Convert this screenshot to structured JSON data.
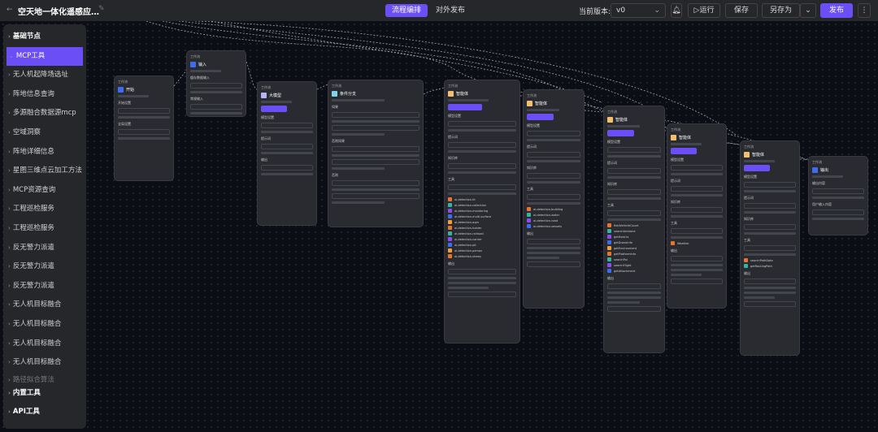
{
  "header": {
    "back_icon": "arrow-left-icon",
    "title": "空天地一体化遥感应…",
    "edit_icon": "pencil-icon",
    "tabs": [
      {
        "label": "流程编排",
        "active": true
      },
      {
        "label": "对外发布",
        "active": false
      }
    ],
    "version_label": "当前版本:",
    "version_value": "v0",
    "bell_icon": "bell-icon",
    "run_label": "▷运行",
    "save_label": "保存",
    "save_as_label": "另存为",
    "save_as_menu_icon": "chevron-down-icon",
    "publish_label": "发布",
    "more_icon": "more-vertical-icon",
    "accent": "#6b4ef6"
  },
  "sidebar": {
    "items": [
      {
        "label": "基础节点",
        "bold": true
      },
      {
        "label": "MCP工具",
        "active": true
      },
      {
        "label": "无人机起降场选址"
      },
      {
        "label": "阵地信息查询"
      },
      {
        "label": "多源融合数据源mcp"
      },
      {
        "label": "空域洞察"
      },
      {
        "label": "阵地详细信息"
      },
      {
        "label": "星图三维点云加工方法"
      },
      {
        "label": "MCP资源查询"
      },
      {
        "label": "工程巡检服务"
      },
      {
        "label": "工程巡检服务"
      },
      {
        "label": "反无警力派遣"
      },
      {
        "label": "反无警力派遣"
      },
      {
        "label": "反无警力派遣"
      },
      {
        "label": "无人机目标融合"
      },
      {
        "label": "无人机目标融合"
      },
      {
        "label": "无人机目标融合"
      },
      {
        "label": "无人机目标融合"
      },
      {
        "label": "路径拟合算法",
        "cut": true
      },
      {
        "label": "内置工具",
        "bold": true
      },
      {
        "label": "API工具",
        "bold": true
      }
    ]
  },
  "nodes": [
    {
      "type": "工作流",
      "title": "开始",
      "color": "#3d6cf0",
      "fields": [
        "开始设置",
        "全局设置"
      ]
    },
    {
      "type": "工作流",
      "title": "输入",
      "color": "#3d6cf0",
      "fields": [
        "缓存数据输入",
        "常规输入"
      ]
    },
    {
      "type": "工作流",
      "title": "大模型",
      "color": "#b9b3f5",
      "fields": [
        "模型设置",
        "提示词",
        "输出"
      ]
    },
    {
      "type": "工作流",
      "title": "条件分支",
      "color": "#7fd4e8",
      "fields": [
        "如果",
        "否则如果",
        "否则"
      ]
    },
    {
      "type": "工作流",
      "title": "智能体",
      "color": "#f3c070",
      "fields": [
        "模型设置",
        "提示词",
        "知识库",
        "工具",
        "输出"
      ],
      "tools": [
        "ai-detection-ht",
        "ai-detection-collection",
        "ai-detection-monitoring",
        "ai-detection-multi-surface",
        "ai-detection-aqm",
        "ai-detection-holder",
        "ai-detection-railroad",
        "ai-detection-carrier",
        "ai-detection-pit",
        "ai-detection-person",
        "ai-detection-sheep"
      ]
    },
    {
      "type": "工作流",
      "title": "智能体",
      "color": "#f3c070",
      "fields": [
        "模型设置",
        "提示词",
        "知识库",
        "工具",
        "输出"
      ],
      "tools": [
        "ai-detection-building",
        "ai-detection-water",
        "ai-detection-road",
        "ai-detection-vessels"
      ]
    },
    {
      "type": "工作流",
      "title": "智能体",
      "color": "#f3c070",
      "fields": [
        "模型设置",
        "提示词",
        "知识库",
        "工具",
        "输出"
      ],
      "tools": [
        "fieldVehicleCount",
        "searchAirdrone",
        "getHeat.ts",
        "getDroneInfo",
        "getEnvironment",
        "getPlatformInfo",
        "searchPoi",
        "searchFlight",
        "getAttachment"
      ]
    },
    {
      "type": "工作流",
      "title": "智能体",
      "color": "#f3c070",
      "fields": [
        "模型设置",
        "提示词",
        "知识库",
        "工具",
        "输出"
      ],
      "tools": [
        "Weather"
      ]
    },
    {
      "type": "工作流",
      "title": "智能体",
      "color": "#f3c070",
      "fields": [
        "模型设置",
        "提示词",
        "知识库",
        "工具",
        "输出"
      ],
      "tools": [
        "searchPathData",
        "getRoutingPath"
      ]
    },
    {
      "type": "工作流",
      "title": "输出",
      "color": "#3d6cf0",
      "fields": [
        "输出内容",
        "用户输入内容"
      ]
    }
  ]
}
